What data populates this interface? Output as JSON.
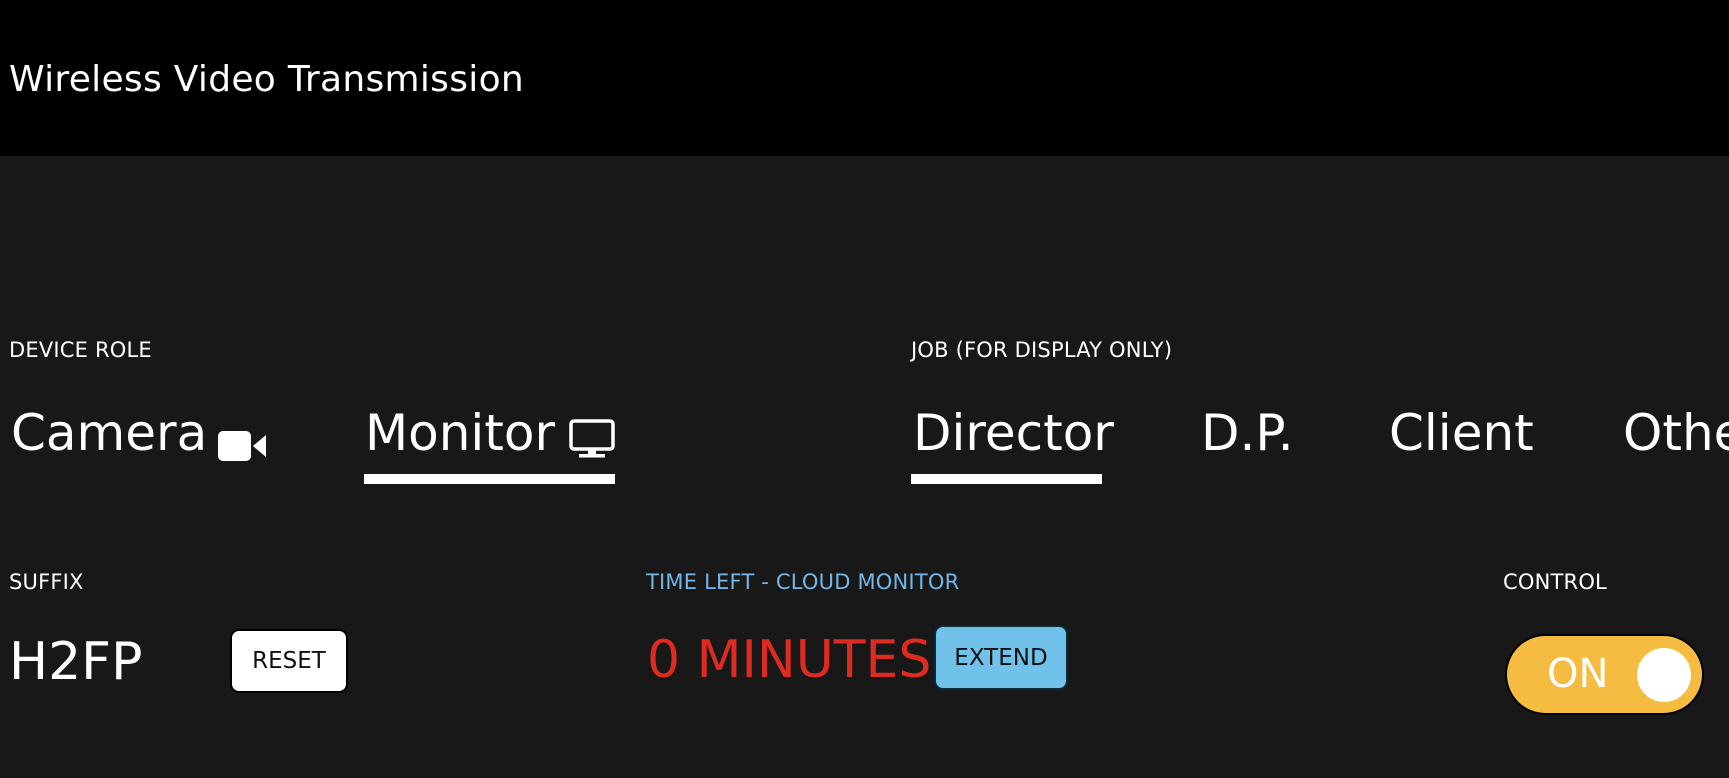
{
  "header": {
    "title": "Wireless Video Transmission"
  },
  "device_role": {
    "label": "DEVICE ROLE",
    "options": [
      {
        "label": "Camera",
        "icon": "video-camera-icon",
        "selected": false
      },
      {
        "label": "Monitor",
        "icon": "monitor-icon",
        "selected": true
      }
    ]
  },
  "job": {
    "label": "JOB (FOR DISPLAY ONLY)",
    "options": [
      {
        "label": "Director",
        "selected": true
      },
      {
        "label": "D.P.",
        "selected": false
      },
      {
        "label": "Client",
        "selected": false
      },
      {
        "label": "Other",
        "selected": false
      }
    ]
  },
  "suffix": {
    "label": "SUFFIX",
    "value": "H2FP",
    "reset_label": "RESET"
  },
  "time_left": {
    "label": "TIME LEFT - CLOUD MONITOR",
    "value": "0 MINUTES",
    "extend_label": "EXTEND"
  },
  "control": {
    "label": "CONTROL",
    "toggle_label": "ON",
    "state": true
  },
  "colors": {
    "background": "#181818",
    "header": "#000000",
    "time_label": "#74b6e6",
    "time_value": "#dd2b22",
    "extend_button": "#70c2ea",
    "toggle_on": "#f5bc41"
  }
}
